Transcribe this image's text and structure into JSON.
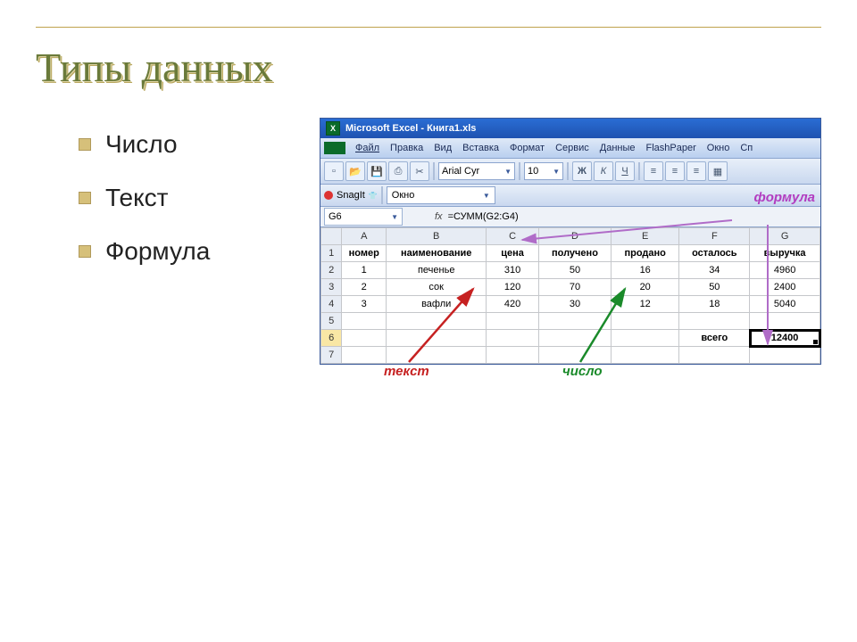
{
  "title": "Типы данных",
  "bullets": [
    "Число",
    "Текст",
    "Формула"
  ],
  "excel": {
    "window_title": "Microsoft Excel - Книга1.xls",
    "menus": [
      "Файл",
      "Правка",
      "Вид",
      "Вставка",
      "Формат",
      "Сервис",
      "Данные",
      "FlashPaper",
      "Окно",
      "Сп"
    ],
    "font_name": "Arial Cyr",
    "font_size": "10",
    "style_buttons": {
      "bold": "Ж",
      "italic": "К",
      "underline": "Ч"
    },
    "snagit_label": "SnagIt",
    "snagit_target": "Окно",
    "name_box": "G6",
    "fx_label": "fx",
    "formula": "=СУММ(G2:G4)"
  },
  "annotations": {
    "formula": "формула",
    "text": "текст",
    "number": "число"
  },
  "chart_data": {
    "type": "table",
    "columns": [
      "A",
      "B",
      "C",
      "D",
      "E",
      "F",
      "G"
    ],
    "headers": [
      "номер",
      "наименование",
      "цена",
      "получено",
      "продано",
      "осталось",
      "выручка"
    ],
    "rows": [
      {
        "номер": 1,
        "наименование": "печенье",
        "цена": 310,
        "получено": 50,
        "продано": 16,
        "осталось": 34,
        "выручка": 4960
      },
      {
        "номер": 2,
        "наименование": "сок",
        "цена": 120,
        "получено": 70,
        "продано": 20,
        "осталось": 50,
        "выручка": 2400
      },
      {
        "номер": 3,
        "наименование": "вафли",
        "цена": 420,
        "получено": 30,
        "продано": 12,
        "осталось": 18,
        "выручка": 5040
      }
    ],
    "summary": {
      "label": "всего",
      "value": 12400
    },
    "active_cell": "G6",
    "formula_bar": "=СУММ(G2:G4)"
  }
}
